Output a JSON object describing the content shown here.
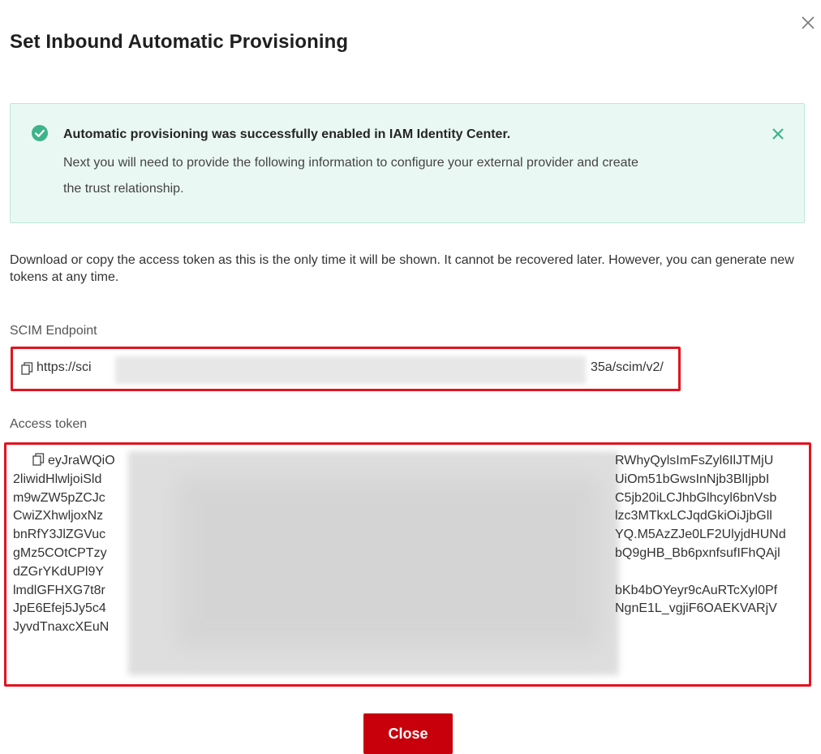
{
  "dialog": {
    "title": "Set Inbound Automatic Provisioning",
    "close_icon": "close-icon"
  },
  "alert": {
    "icon": "check-circle-icon",
    "title": "Automatic provisioning was successfully enabled in IAM Identity Center.",
    "line1": "Next you will need to provide the following information to configure your external provider and create",
    "line2": "the trust relationship.",
    "close_icon": "close-icon",
    "accent_color": "#3db48a"
  },
  "description": "Download or copy the access token as this is the only time it will be shown. It cannot be recovered later. However, you can generate new tokens at any time.",
  "scim_endpoint": {
    "label": "SCIM Endpoint",
    "copy_icon": "copy-icon",
    "value_prefix": "https://sci",
    "value_suffix": "35a/scim/v2/"
  },
  "access_token": {
    "label": "Access token",
    "copy_icon": "copy-icon",
    "lines_left": [
      "eyJraWQiO",
      "2liwidHlwljoiSld",
      "m9wZW5pZCJc",
      "CwiZXhwljoxNz",
      "bnRfY3JlZGVuc",
      "gMz5COtCPTzy",
      "dZGrYKdUPl9Y",
      "lmdlGFHXG7t8r",
      "JpE6Efej5Jy5c4",
      "JyvdTnaxcXEuN"
    ],
    "lines_right": [
      "RWhyQylsImFsZyl6IlJTMjU",
      "UiOm51bGwsInNjb3BlIjpbI",
      "C5jb20iLCJhbGlhcyl6bnVsb",
      "lzc3MTkxLCJqdGkiOiJjbGll",
      "YQ.M5AzZJe0LF2UlyjdHUNd",
      "bQ9gHB_Bb6pxnfsufIFhQAjl",
      "",
      "bKb4bOYeyr9cAuRTcXyl0Pf",
      "NgnE1L_vgjiF6OAEKVARjV",
      ""
    ]
  },
  "footer": {
    "close_label": "Close",
    "button_color": "#c7000b"
  },
  "highlight_color": "#e3131f"
}
